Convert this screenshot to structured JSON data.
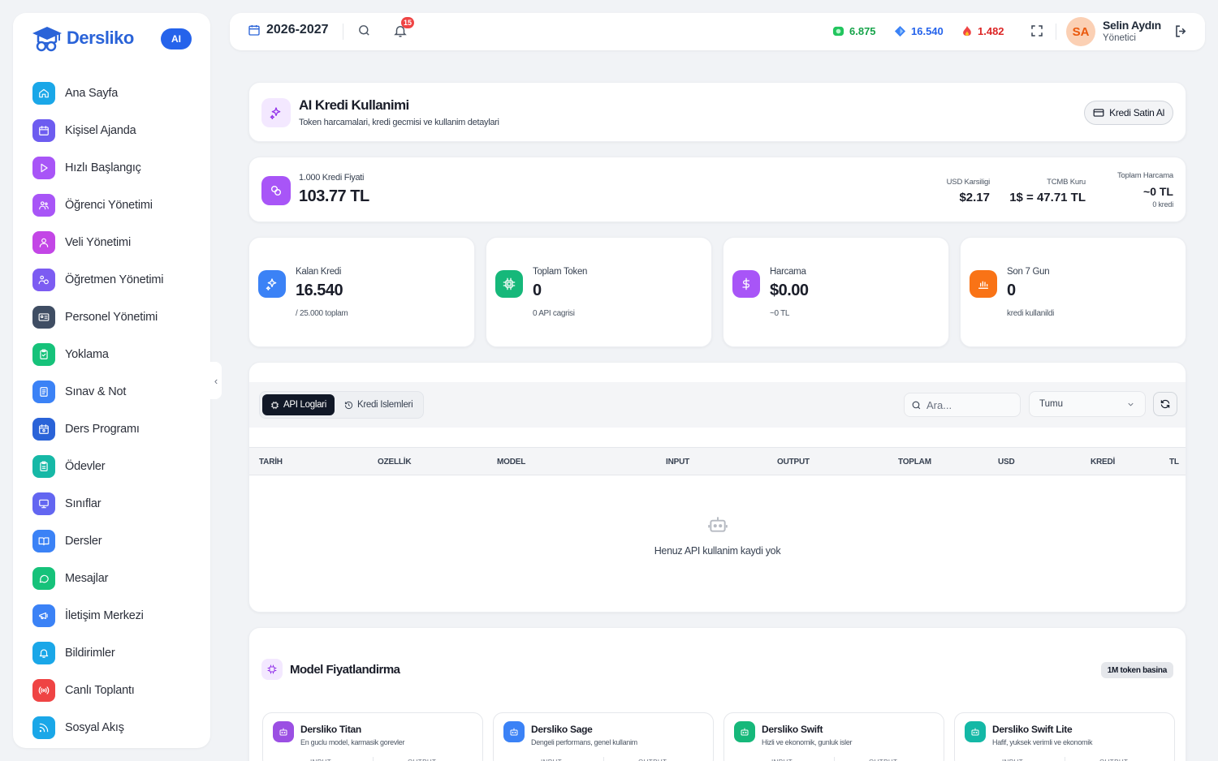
{
  "brand": {
    "name": "Dersliko",
    "ai_badge": "AI"
  },
  "sidebar": {
    "items": [
      {
        "label": "Ana Sayfa",
        "icon": "home-icon",
        "color": "#1aa7e8"
      },
      {
        "label": "Kişisel Ajanda",
        "icon": "calendar-icon",
        "color": "#6d5cf0"
      },
      {
        "label": "Hızlı Başlangıç",
        "icon": "play-icon",
        "color": "#a855f7"
      },
      {
        "label": "Öğrenci Yönetimi",
        "icon": "users-icon",
        "color": "#a855f7"
      },
      {
        "label": "Veli Yönetimi",
        "icon": "user-group-icon",
        "color": "#c346e6"
      },
      {
        "label": "Öğretmen Yönetimi",
        "icon": "teacher-icon",
        "color": "#7c5cf2"
      },
      {
        "label": "Personel Yönetimi",
        "icon": "id-card-icon",
        "color": "#3f4d63"
      },
      {
        "label": "Yoklama",
        "icon": "clipboard-check-icon",
        "color": "#16c27a"
      },
      {
        "label": "Sınav & Not",
        "icon": "exam-icon",
        "color": "#3b82f6"
      },
      {
        "label": "Ders Programı",
        "icon": "schedule-icon",
        "color": "#2a63d8"
      },
      {
        "label": "Ödevler",
        "icon": "homework-icon",
        "color": "#16b8a6"
      },
      {
        "label": "Sınıflar",
        "icon": "monitor-icon",
        "color": "#6366f1"
      },
      {
        "label": "Dersler",
        "icon": "book-icon",
        "color": "#3b82f6"
      },
      {
        "label": "Mesajlar",
        "icon": "message-icon",
        "color": "#16c27a"
      },
      {
        "label": "İletişim Merkezi",
        "icon": "megaphone-icon",
        "color": "#3b82f6"
      },
      {
        "label": "Bildirimler",
        "icon": "bell-icon",
        "color": "#1aa7e8"
      },
      {
        "label": "Canlı Toplantı",
        "icon": "broadcast-icon",
        "color": "#ef4444"
      },
      {
        "label": "Sosyal Akış",
        "icon": "rss-icon",
        "color": "#1aa7e8"
      }
    ]
  },
  "topbar": {
    "year": "2026-2027",
    "notif_count": "15",
    "coins": "6.875",
    "gems": "16.540",
    "fire": "1.482",
    "user_initials": "SA",
    "user_name": "Selin Aydın",
    "user_role": "Yönetici"
  },
  "header": {
    "title": "AI Kredi Kullanimi",
    "subtitle": "Token harcamalari, kredi gecmisi ve kullanim detaylari",
    "buy_button": "Kredi Satin Al"
  },
  "price": {
    "label": "1.000 Kredi Fiyati",
    "value": "103.77 TL",
    "usd_label": "USD Karsiligi",
    "usd_value": "$2.17",
    "tcmb_label": "TCMB Kuru",
    "tcmb_value": "1$ = 47.71 TL",
    "total_label": "Toplam Harcama",
    "total_value": "~0 TL",
    "total_sub": "0 kredi"
  },
  "stats": [
    {
      "label": "Kalan Kredi",
      "value": "16.540",
      "sub": "/ 25.000 toplam",
      "color": "#3b82f6",
      "icon": "sparkle-icon"
    },
    {
      "label": "Toplam Token",
      "value": "0",
      "sub": "0 API cagrisi",
      "color": "#16b87a",
      "icon": "chip-icon"
    },
    {
      "label": "Harcama",
      "value": "$0.00",
      "sub": "~0 TL",
      "color": "#a855f7",
      "icon": "dollar-icon"
    },
    {
      "label": "Son 7 Gun",
      "value": "0",
      "sub": "kredi kullanildi",
      "color": "#f97316",
      "icon": "bar-chart-icon"
    }
  ],
  "logs": {
    "tabs": [
      "API Loglari",
      "Kredi Islemleri"
    ],
    "search_placeholder": "Ara...",
    "filter": "Tumu",
    "columns": [
      "TARİH",
      "OZELLİK",
      "MODEL",
      "INPUT",
      "OUTPUT",
      "TOPLAM",
      "USD",
      "KREDİ",
      "TL"
    ],
    "empty": "Henuz API kullanim kaydi yok"
  },
  "pricing": {
    "title": "Model Fiyatlandirma",
    "pill": "1M token basina",
    "models": [
      {
        "name": "Dersliko Titan",
        "desc": "En guclu model, karmasik gorevler",
        "color": "#9b4fe3",
        "in": "INPUT",
        "out": "OUTPUT"
      },
      {
        "name": "Dersliko Sage",
        "desc": "Dengeli performans, genel kullanim",
        "color": "#3b82f6",
        "in": "INPUT",
        "out": "OUTPUT"
      },
      {
        "name": "Dersliko Swift",
        "desc": "Hizli ve ekonomik, gunluk isler",
        "color": "#16b87a",
        "in": "INPUT",
        "out": "OUTPUT"
      },
      {
        "name": "Dersliko Swift Lite",
        "desc": "Hafif, yuksek verimli ve ekonomik",
        "color": "#14b8a6",
        "in": "INPUT",
        "out": "OUTPUT"
      }
    ]
  }
}
